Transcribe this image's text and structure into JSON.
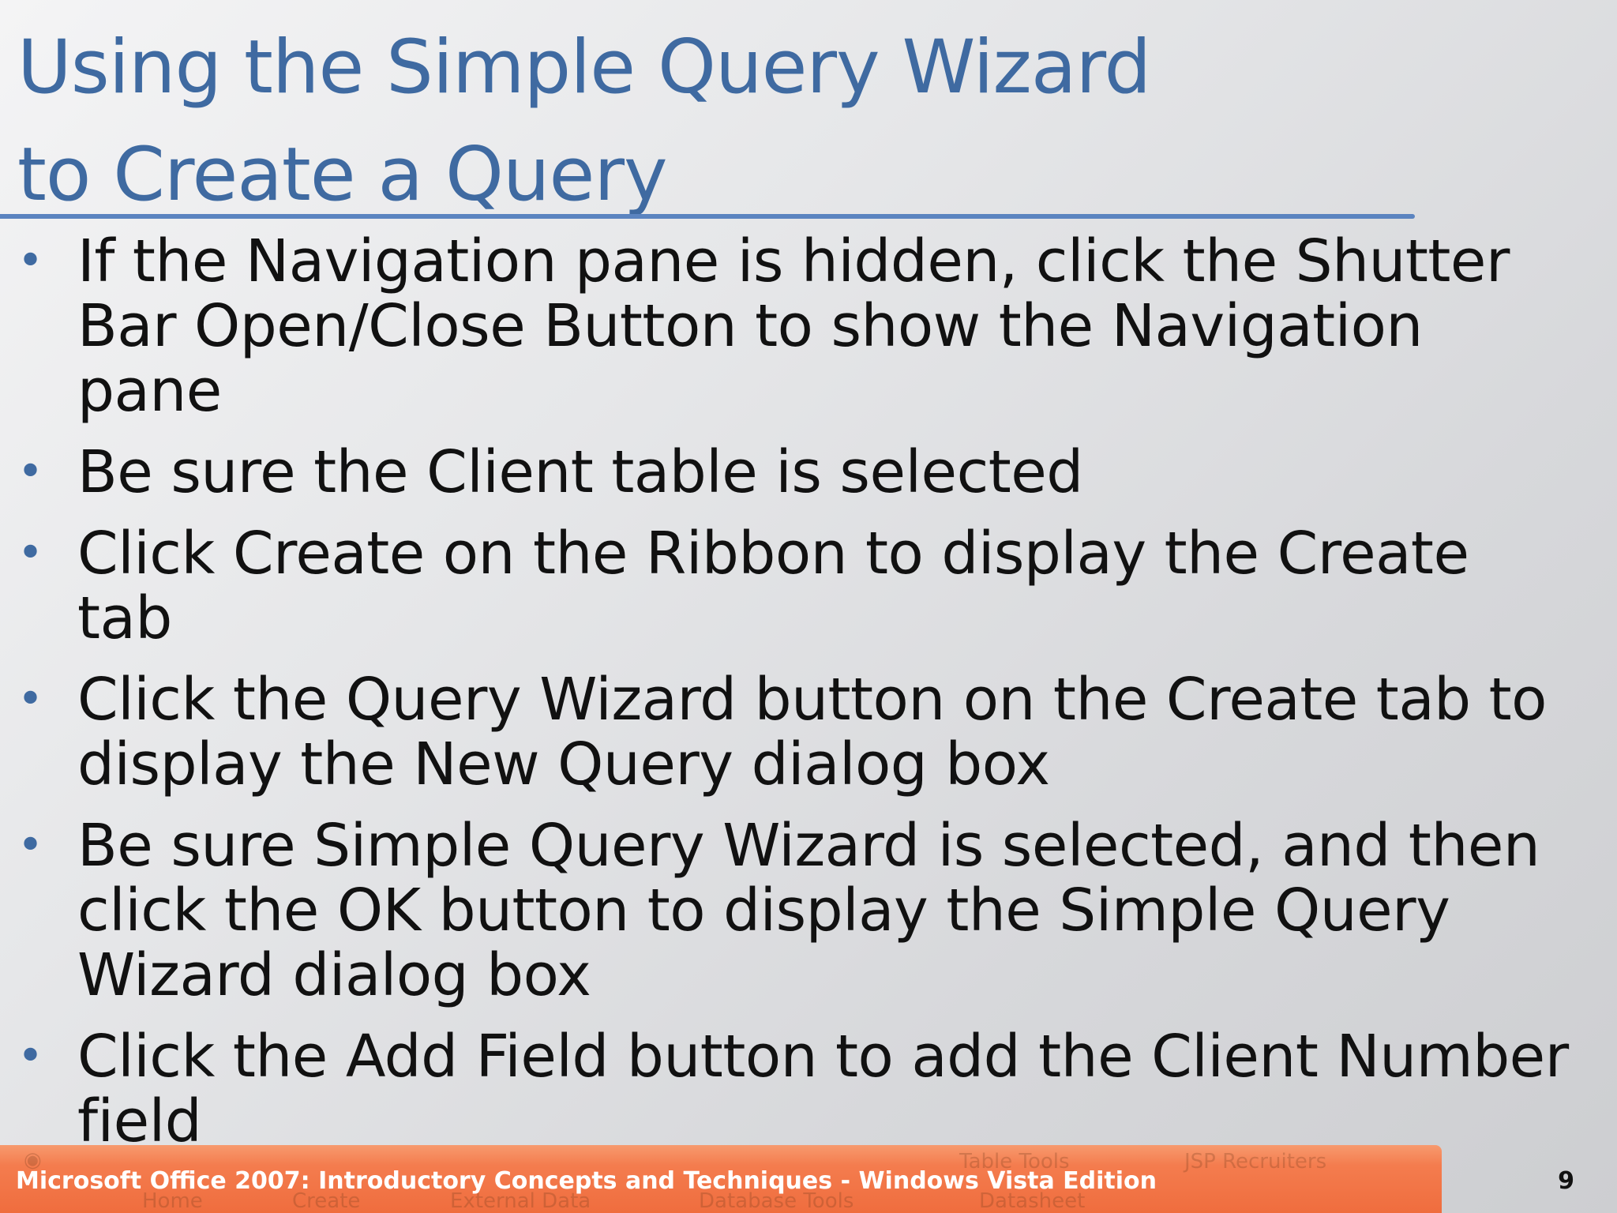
{
  "slide": {
    "title_line1": "Using the Simple Query Wizard",
    "title_line2": "to Create a Query",
    "bullets": [
      {
        "line1": "If the Navigation pane is hidden, click the Shutter",
        "line2": "Bar Open/Close Button to show the Navigation pane",
        "line3": ""
      },
      {
        "line1": "Be sure the Client table is selected",
        "line2": "",
        "line3": ""
      },
      {
        "line1": "Click Create on the Ribbon to display the Create tab",
        "line2": "",
        "line3": ""
      },
      {
        "line1": "Click the Query Wizard button on the Create tab to",
        "line2": "display the New Query dialog box",
        "line3": ""
      },
      {
        "line1": "Be sure Simple Query Wizard is selected, and then",
        "line2": "click the OK button to display the Simple Query",
        "line3": "Wizard dialog box"
      },
      {
        "line1": "Click the Add Field button to add the Client Number",
        "line2": "field",
        "line3": ""
      }
    ],
    "bullet_symbol": "•",
    "footer_text": "Microsoft Office 2007: Introductory Concepts and Techniques - Windows Vista Edition",
    "page_number": "9",
    "footer_background_ghost_text": {
      "tab_home": "Home",
      "tab_create": "Create",
      "tab_external_data": "External Data",
      "tab_database_tools": "Database Tools",
      "tab_datasheet": "Datasheet",
      "table_tools": "Table Tools",
      "window_title": "JSP Recruiters"
    }
  },
  "colors": {
    "title": "#3f6aa1",
    "rule": "#5b84c0",
    "body_text": "#111111",
    "footer_bar": "#ef6d3e",
    "footer_text": "#ffffff"
  }
}
